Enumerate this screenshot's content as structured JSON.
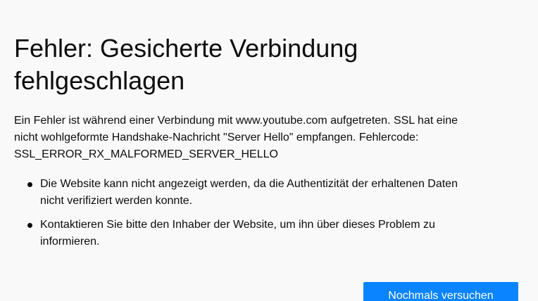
{
  "error": {
    "title_line1": "Fehler: Gesicherte Verbindung",
    "title_line2": "fehlgeschlagen",
    "description_line1": "Ein Fehler ist während einer Verbindung mit www.youtube.com aufgetreten. SSL hat eine",
    "description_line2": "nicht wohlgeformte Handshake-Nachricht \"Server Hello\" empfangen. Fehlercode:",
    "error_code": "SSL_ERROR_RX_MALFORMED_SERVER_HELLO",
    "bullets": [
      {
        "line1": "Die Website kann nicht angezeigt werden, da die Authentizität der erhaltenen Daten",
        "line2": "nicht verifiziert werden konnte."
      },
      {
        "line1": "Kontaktieren Sie bitte den Inhaber der Website, um ihn über dieses Problem zu",
        "line2": "informieren."
      }
    ],
    "retry_label": "Nochmals versuchen"
  },
  "colors": {
    "background": "#f9f9fa",
    "text": "#0c0c0d",
    "button": "#0a84ff",
    "button_text": "#ffffff"
  }
}
